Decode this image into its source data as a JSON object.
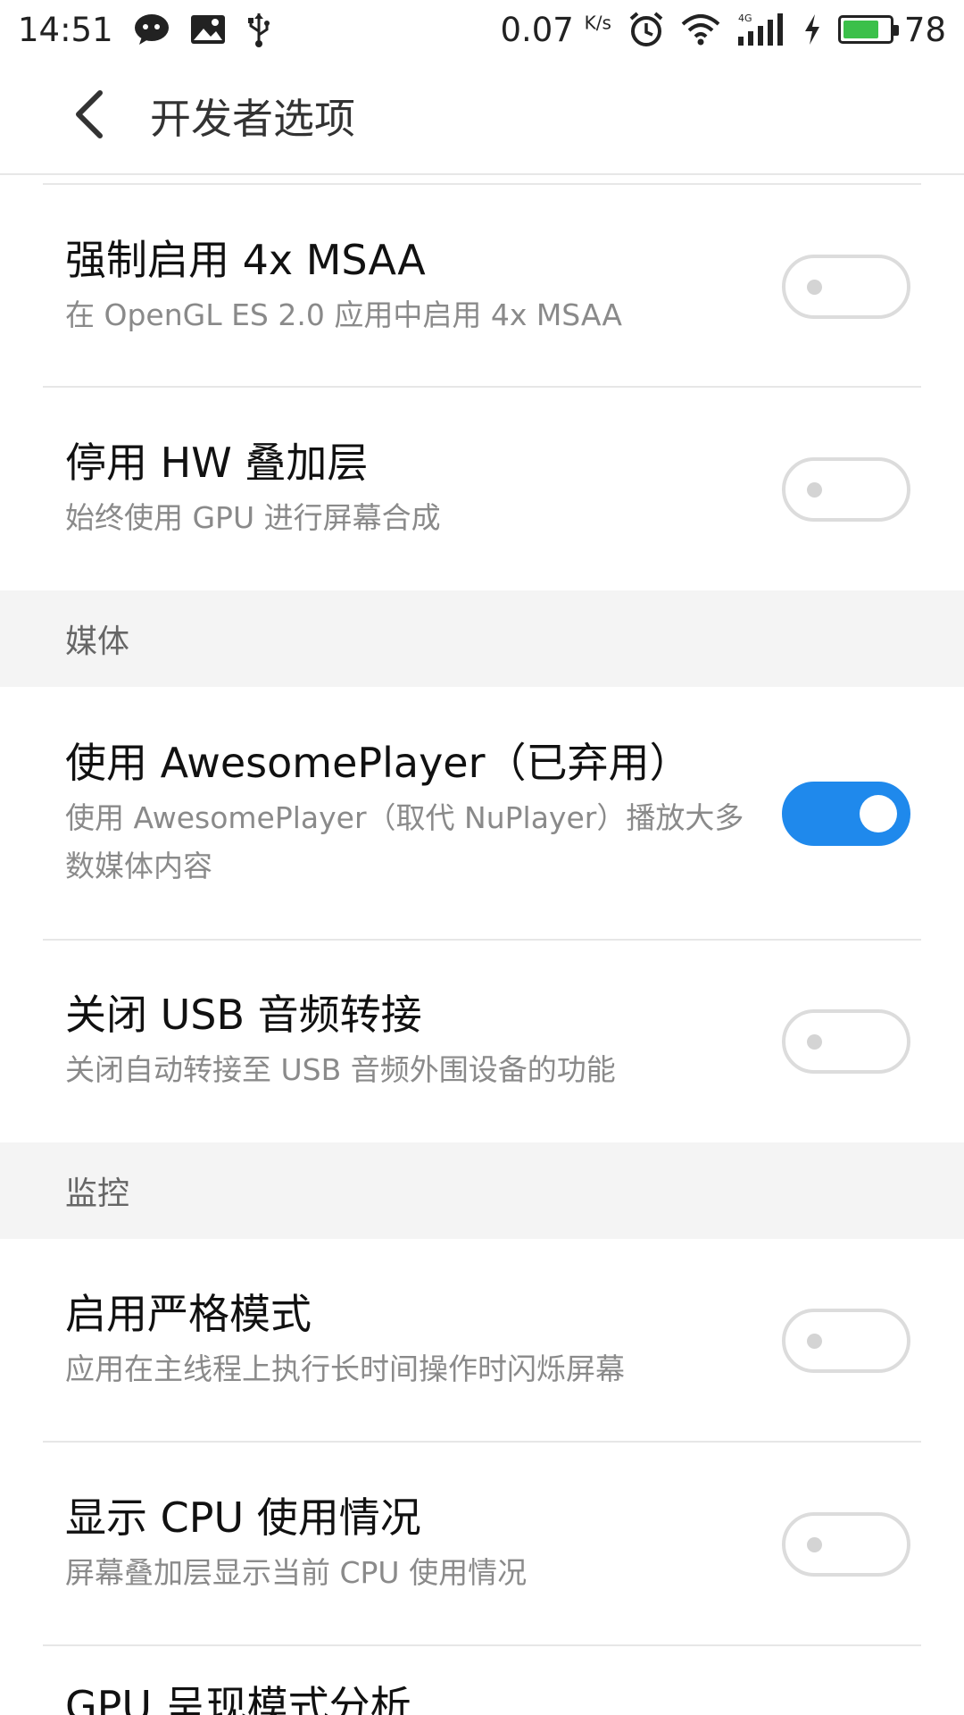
{
  "status_bar": {
    "time": "14:51",
    "net_speed": "0.07",
    "net_unit": "K/s",
    "battery_level": "78",
    "battery_fraction": 0.78,
    "accent_battery": "#3bc04a",
    "icons": [
      "wechat-icon",
      "image-icon",
      "usb-icon",
      "alarm-icon",
      "wifi-icon",
      "signal-4g-icon",
      "charging-icon",
      "battery-icon"
    ]
  },
  "header": {
    "title": "开发者选项",
    "back_icon": "chevron-left-icon"
  },
  "items_group1": [
    {
      "title": "强制启用 4x MSAA",
      "subtitle": "在 OpenGL ES 2.0 应用中启用 4x MSAA",
      "enabled": false
    },
    {
      "title": "停用 HW 叠加层",
      "subtitle": "始终使用 GPU 进行屏幕合成",
      "enabled": false
    }
  ],
  "section_media": {
    "label": "媒体"
  },
  "items_group2": [
    {
      "title": "使用 AwesomePlayer（已弃用）",
      "subtitle": "使用 AwesomePlayer（取代 NuPlayer）播放大多数媒体内容",
      "enabled": true
    },
    {
      "title": "关闭 USB 音频转接",
      "subtitle": "关闭自动转接至 USB 音频外围设备的功能",
      "enabled": false
    }
  ],
  "section_monitor": {
    "label": "监控"
  },
  "items_group3": [
    {
      "title": "启用严格模式",
      "subtitle": "应用在主线程上执行长时间操作时闪烁屏幕",
      "enabled": false
    },
    {
      "title": "显示 CPU 使用情况",
      "subtitle": "屏幕叠加层显示当前 CPU 使用情况",
      "enabled": false
    },
    {
      "title": "GPU 呈现模式分析"
    }
  ],
  "colors": {
    "toggle_on": "#1f89ec",
    "toggle_off_border": "#dcdcdc",
    "section_bg": "#f4f4f4"
  }
}
